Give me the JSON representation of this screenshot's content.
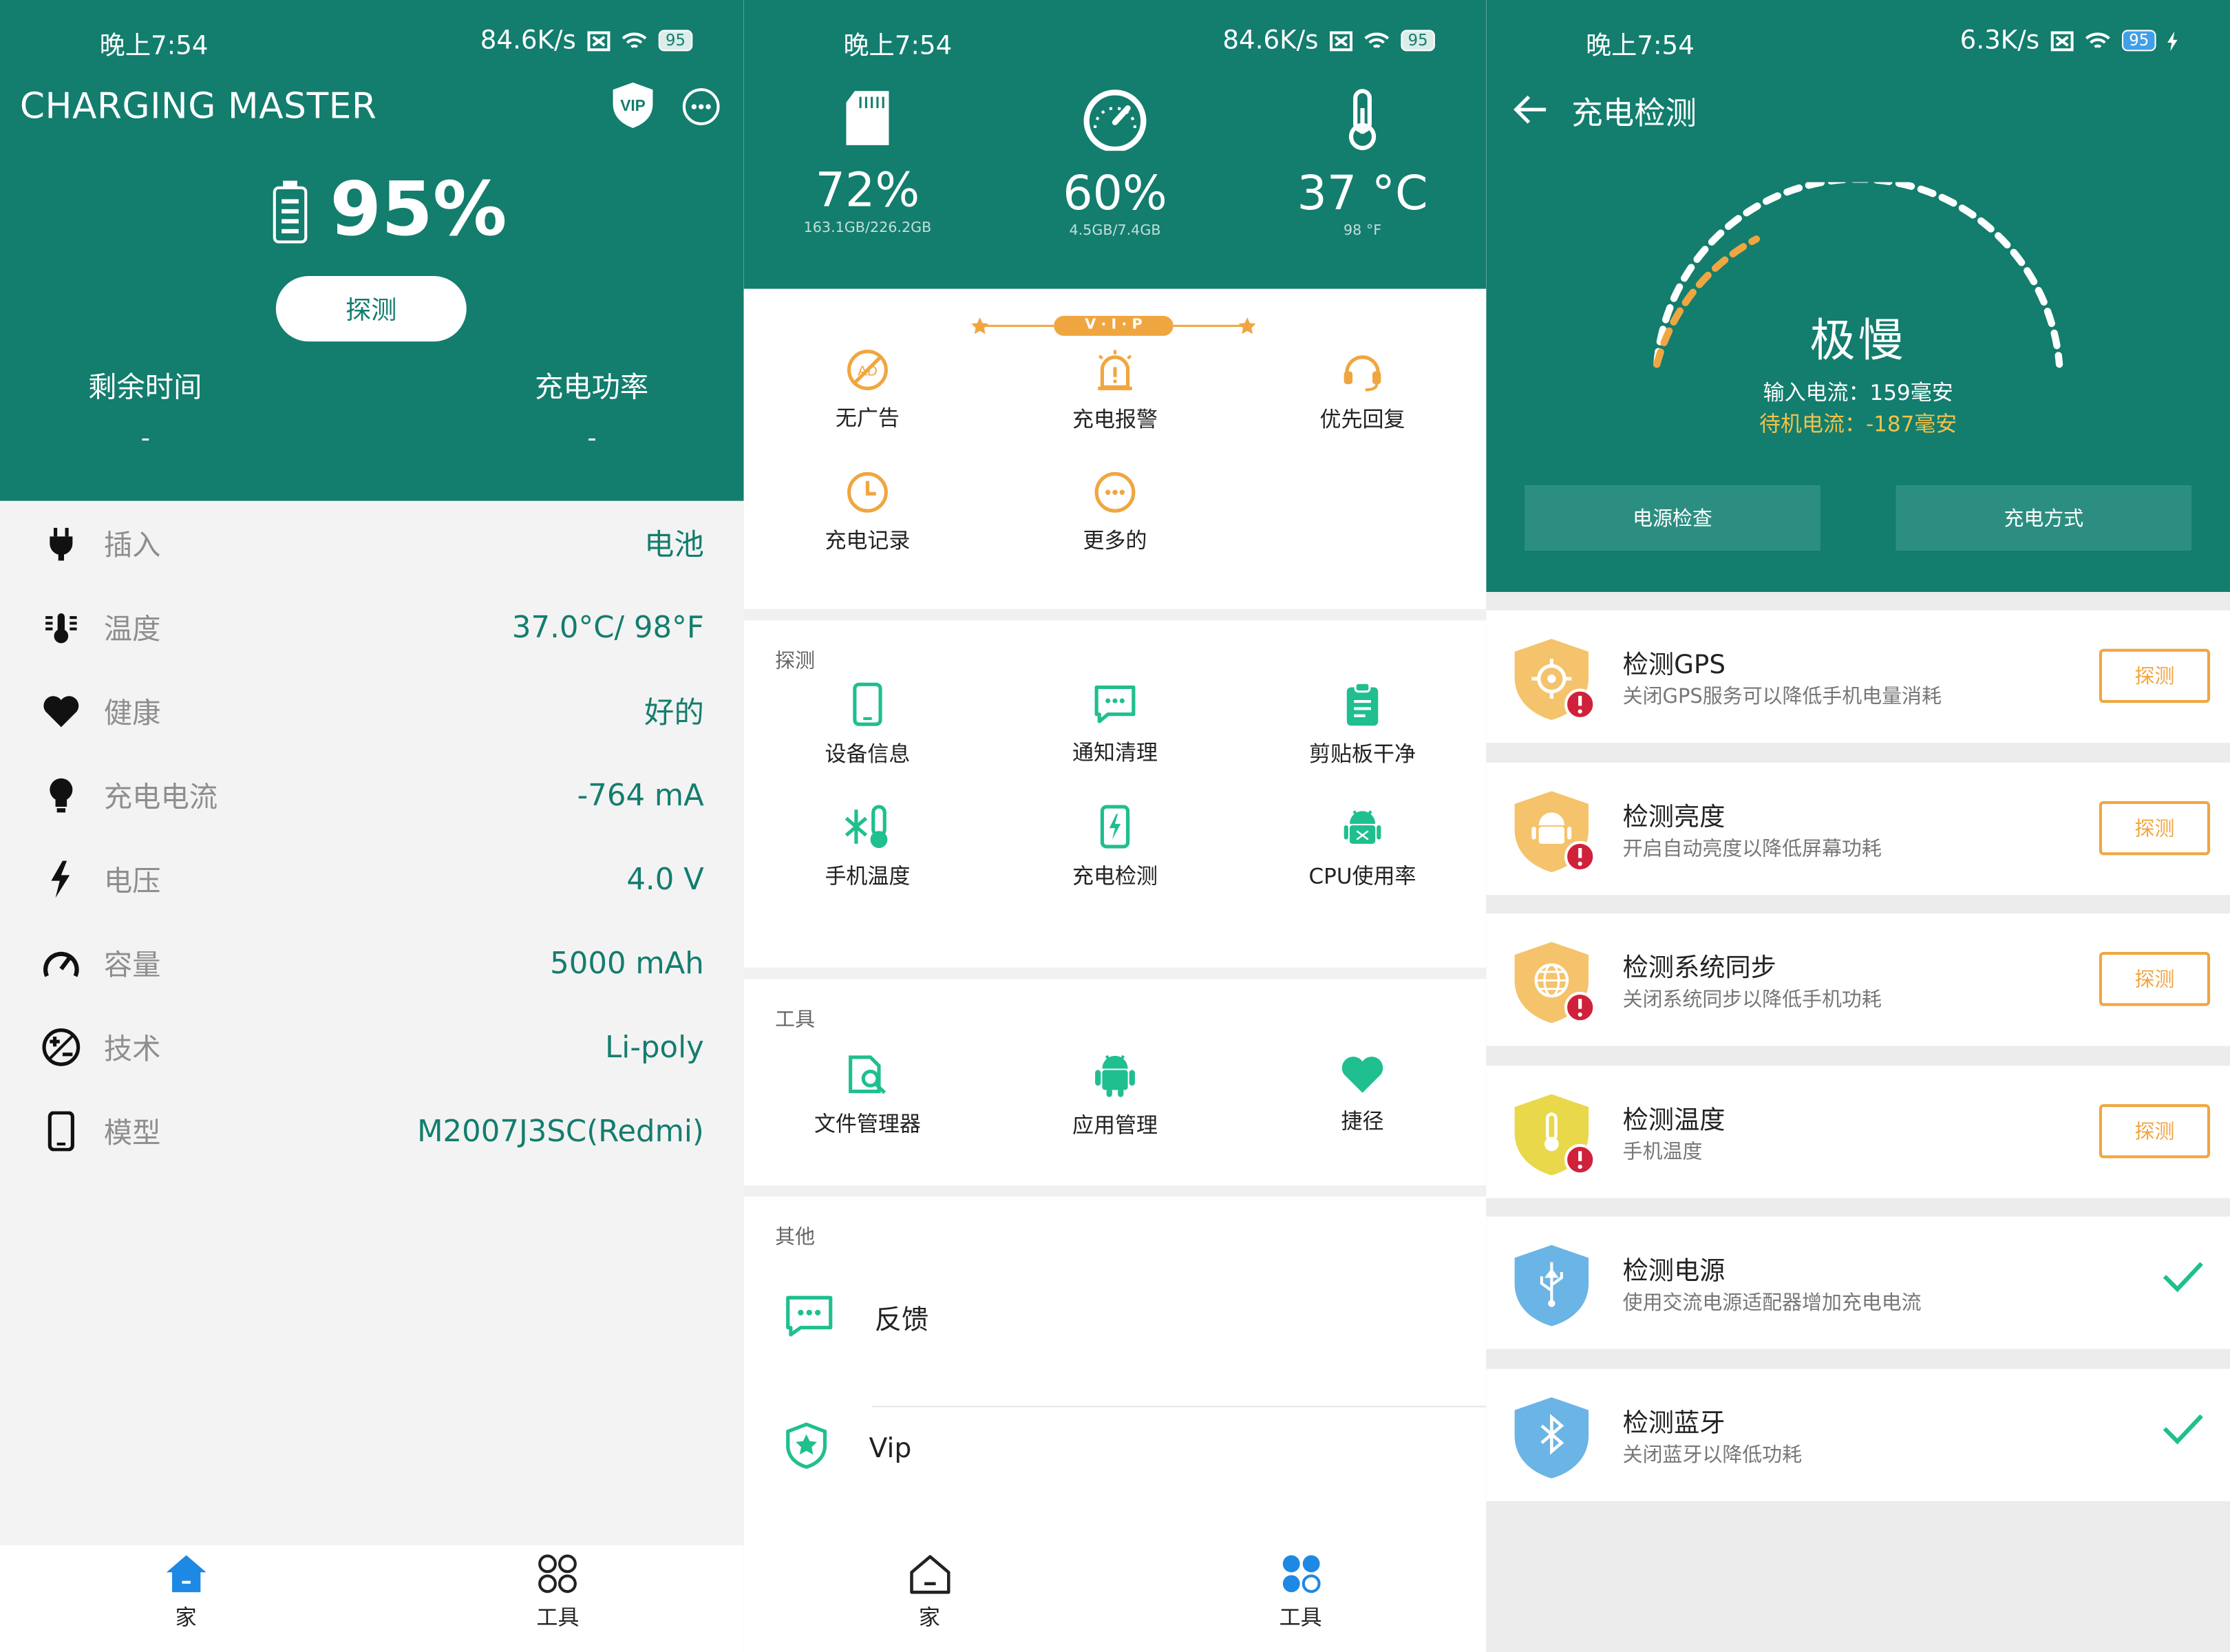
{
  "status_bar": {
    "p1": {
      "time": "晚上7:54",
      "speed": "84.6K/s",
      "battery": "95"
    },
    "p2": {
      "time": "晚上7:54",
      "speed": "84.6K/s",
      "battery": "95"
    },
    "p3": {
      "time": "晚上7:54",
      "speed": "6.3K/s",
      "battery": "95"
    }
  },
  "home": {
    "app_title": "CHARGING MASTER",
    "vip_badge": "VIP",
    "battery_percent": "95%",
    "detect_button": "探测",
    "remaining_label": "剩余时间",
    "remaining_value": "-",
    "power_label": "充电功率",
    "power_value": "-",
    "rows": [
      {
        "label": "插入",
        "value": "电池",
        "icon": "plug-icon"
      },
      {
        "label": "温度",
        "value": "37.0°C/ 98°F",
        "icon": "thermometer-icon"
      },
      {
        "label": "健康",
        "value": "好的",
        "icon": "heart-icon"
      },
      {
        "label": "充电电流",
        "value": "-764 mA",
        "icon": "bulb-icon"
      },
      {
        "label": "电压",
        "value": "4.0 V",
        "icon": "bolt-icon"
      },
      {
        "label": "容量",
        "value": "5000 mAh",
        "icon": "gauge-icon"
      },
      {
        "label": "技术",
        "value": "Li-poly",
        "icon": "plus-minus-icon"
      },
      {
        "label": "模型",
        "value": "M2007J3SC(Redmi)",
        "icon": "phone-icon"
      }
    ]
  },
  "nav": {
    "home": "家",
    "tools": "工具"
  },
  "tools": {
    "metrics": [
      {
        "value": "72%",
        "sub": "163.1GB/226.2GB",
        "icon": "sd-card-icon"
      },
      {
        "value": "60%",
        "sub": "4.5GB/7.4GB",
        "icon": "speedometer-icon"
      },
      {
        "value": "37 °C",
        "sub": "98 °F",
        "icon": "thermometer-icon"
      }
    ],
    "vip_banner": "V · I · P",
    "vip_items": [
      {
        "label": "无广告",
        "icon": "no-ad-icon"
      },
      {
        "label": "充电报警",
        "icon": "alarm-icon"
      },
      {
        "label": "优先回复",
        "icon": "headset-icon"
      },
      {
        "label": "充电记录",
        "icon": "clock-icon"
      },
      {
        "label": "更多的",
        "icon": "more-icon"
      }
    ],
    "detect_title": "探测",
    "detect_items": [
      {
        "label": "设备信息",
        "icon": "phone-icon"
      },
      {
        "label": "通知清理",
        "icon": "chat-icon"
      },
      {
        "label": "剪贴板干净",
        "icon": "clipboard-icon"
      },
      {
        "label": "手机温度",
        "icon": "snow-thermo-icon"
      },
      {
        "label": "充电检测",
        "icon": "charge-icon"
      },
      {
        "label": "CPU使用率",
        "icon": "android-icon"
      }
    ],
    "tools_title": "工具",
    "tool_items": [
      {
        "label": "文件管理器",
        "icon": "file-search-icon"
      },
      {
        "label": "应用管理",
        "icon": "android-icon"
      },
      {
        "label": "捷径",
        "icon": "heart-icon"
      }
    ],
    "other_title": "其他",
    "other_items": [
      {
        "label": "反馈",
        "icon": "chat-icon"
      },
      {
        "label": "Vip",
        "icon": "star-shield-icon"
      }
    ]
  },
  "check": {
    "title": "充电检测",
    "speed": "极慢",
    "input_current": "输入电流：159毫安",
    "standby_current": "待机电流：-187毫安",
    "btn_power": "电源检查",
    "btn_mode": "充电方式",
    "detect_label": "探测",
    "items": [
      {
        "title": "检测GPS",
        "sub": "关闭GPS服务可以降低手机电量消耗",
        "state": "detect",
        "color": "#f5c36b"
      },
      {
        "title": "检测亮度",
        "sub": "开启自动亮度以降低屏幕功耗",
        "state": "detect",
        "color": "#f5c36b"
      },
      {
        "title": "检测系统同步",
        "sub": "关闭系统同步以降低手机功耗",
        "state": "detect",
        "color": "#f5c36b"
      },
      {
        "title": "检测温度",
        "sub": "手机温度",
        "state": "detect",
        "color": "#e8d84a"
      },
      {
        "title": "检测电源",
        "sub": "使用交流电源适配器增加充电电流",
        "state": "ok",
        "color": "#6bb4e6"
      },
      {
        "title": "检测蓝牙",
        "sub": "关闭蓝牙以降低功耗",
        "state": "ok",
        "color": "#6bb4e6"
      }
    ]
  },
  "colors": {
    "teal": "#137d6e",
    "accent_orange": "#f0a640",
    "green": "#1fbf8f"
  }
}
